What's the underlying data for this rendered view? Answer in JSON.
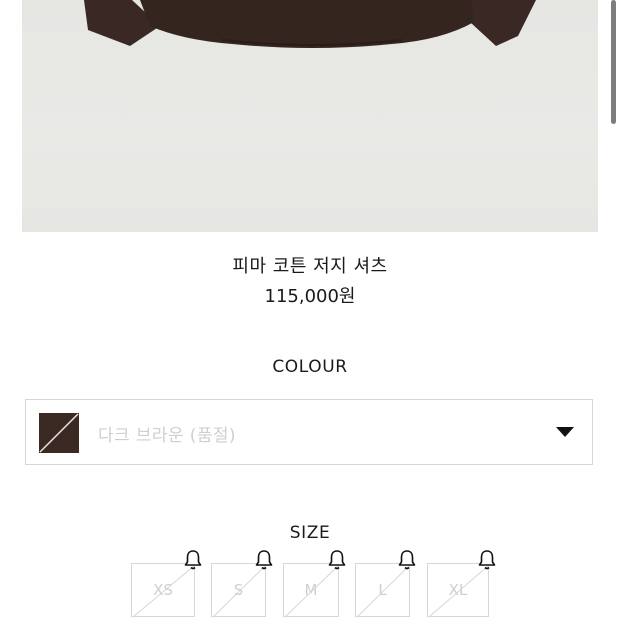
{
  "product": {
    "name": "피마 코튼 저지 셔츠",
    "price": "115,000원",
    "image_icon": "dark-brown-shirt-image"
  },
  "colour": {
    "heading": "COLOUR",
    "selected": "다크 브라운 (품절)",
    "swatch_color": "#3b2a24",
    "sold_out": true
  },
  "size": {
    "heading": "SIZE",
    "options": [
      {
        "label": "XS",
        "sold_out": true
      },
      {
        "label": "S",
        "sold_out": true
      },
      {
        "label": "M",
        "sold_out": true
      },
      {
        "label": "L",
        "sold_out": true
      },
      {
        "label": "XL",
        "sold_out": true
      }
    ],
    "notify_icon": "bell-icon"
  },
  "colors": {
    "text": "#1a1a1a",
    "muted": "#cfcfcf",
    "border": "#d7d7d7",
    "shirt": "#3a2824",
    "image_bg": "#e7e7e4"
  }
}
